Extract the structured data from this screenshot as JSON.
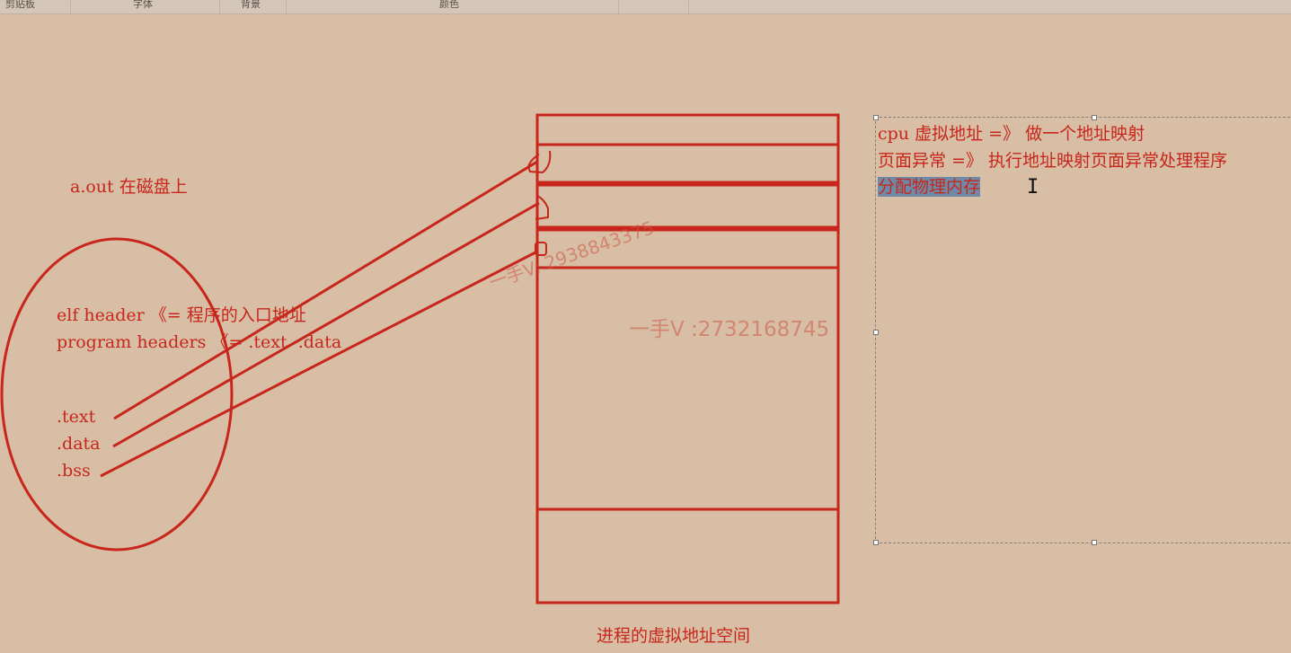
{
  "ribbon": {
    "groups": [
      "剪贴板",
      "字体",
      "背景",
      "颜色"
    ]
  },
  "canvas": {
    "disk_label": "a.out 在磁盘上",
    "elf_lines": [
      "elf header 《= 程序的入口地址",
      "program headers 《= .text  .data"
    ],
    "sections": [
      ".text",
      ".data",
      ".bss"
    ],
    "caption": "进程的虚拟地址空间",
    "watermark_1": "一手V: 2938843375",
    "watermark_2": "一手V :2732168745"
  },
  "textbox": {
    "lines": [
      "cpu 虚拟地址 =》 做一个地址映射",
      "页面异常 =》 执行地址映射页面异常处理程序"
    ],
    "selected_text": "分配物理内存"
  },
  "colors": {
    "background": "#d7bea4",
    "ink": "#c8261c",
    "selection": "#6e8aa6"
  }
}
